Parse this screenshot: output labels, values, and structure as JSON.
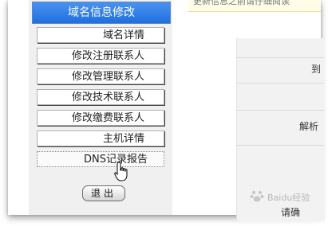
{
  "sidebar": {
    "title": "域名信息修改",
    "items": [
      {
        "label": "域名详情"
      },
      {
        "label": "修改注册联系人"
      },
      {
        "label": "修改管理联系人"
      },
      {
        "label": "修改技术联系人"
      },
      {
        "label": "修改缴费联系人"
      },
      {
        "label": "主机详情"
      },
      {
        "label": "DNS记录报告"
      }
    ],
    "exit_label": "退出"
  },
  "content": {
    "top_note": "更新信息之前请仔细阅读",
    "fragments": [
      "到",
      "解析",
      "请确"
    ]
  },
  "watermark": {
    "text": "Baidu经验"
  },
  "colors": {
    "header_blue": "#1f6fe0",
    "sidebar_bg": "#f0f0f0",
    "panel_bg": "#f2f2f2"
  }
}
